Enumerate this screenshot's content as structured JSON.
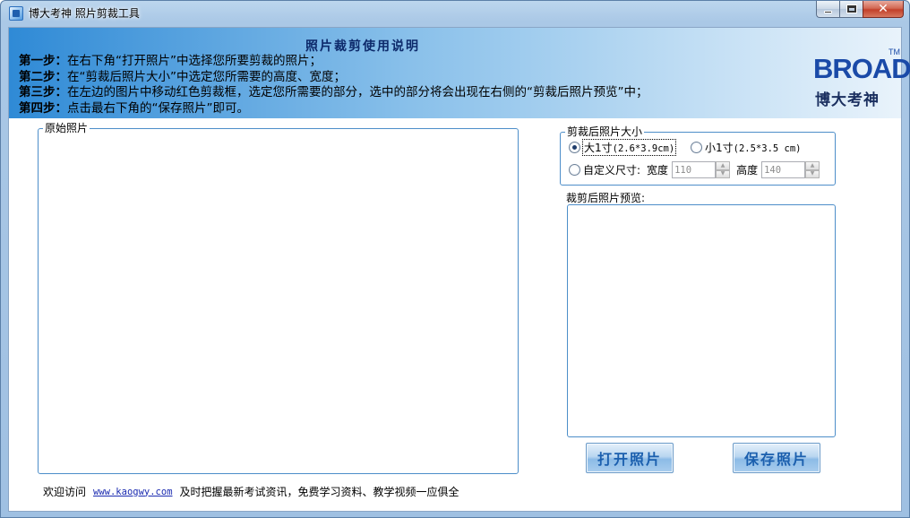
{
  "window": {
    "title": "博大考神 照片剪裁工具",
    "colors": {
      "title_bar": "#9fc0e2",
      "close_button": "#c2402a",
      "accent": "#4d8ec9",
      "button_text": "#1b5fae"
    }
  },
  "banner": {
    "title": "照片裁剪使用说明",
    "steps": [
      {
        "label": "第一步：",
        "text": "在右下角“打开照片”中选择您所要剪裁的照片；"
      },
      {
        "label": "第二步：",
        "text": "在“剪裁后照片大小”中选定您所需要的高度、宽度；"
      },
      {
        "label": "第三步：",
        "text": "在左边的图片中移动红色剪裁框，选定您所需要的部分，选中的部分将会出现在右侧的“剪裁后照片预览”中；"
      },
      {
        "label": "第四步：",
        "text": "点击最右下角的“保存照片”即可。"
      }
    ],
    "brand_word": "BROAD",
    "brand_tm": "TM",
    "brand_cn": "博大考神"
  },
  "original": {
    "legend": "原始照片"
  },
  "size_group": {
    "legend": "剪裁后照片大小",
    "option_large": {
      "label": "大1寸",
      "dims": "(2.6*3.9cm)",
      "checked": true
    },
    "option_small": {
      "label": "小1寸",
      "dims": "(2.5*3.5 cm)",
      "checked": false
    },
    "option_custom": {
      "label": "自定义尺寸:",
      "checked": false
    },
    "width_label": "宽度",
    "width_value": "110",
    "height_label": "高度",
    "height_value": "140"
  },
  "preview": {
    "label": "裁剪后照片预览:"
  },
  "buttons": {
    "open": "打开照片",
    "save": "保存照片"
  },
  "footer": {
    "prefix": "欢迎访问",
    "link": "www.kaogwy.com",
    "suffix": "及时把握最新考试资讯，免费学习资料、教学视频一应俱全"
  }
}
